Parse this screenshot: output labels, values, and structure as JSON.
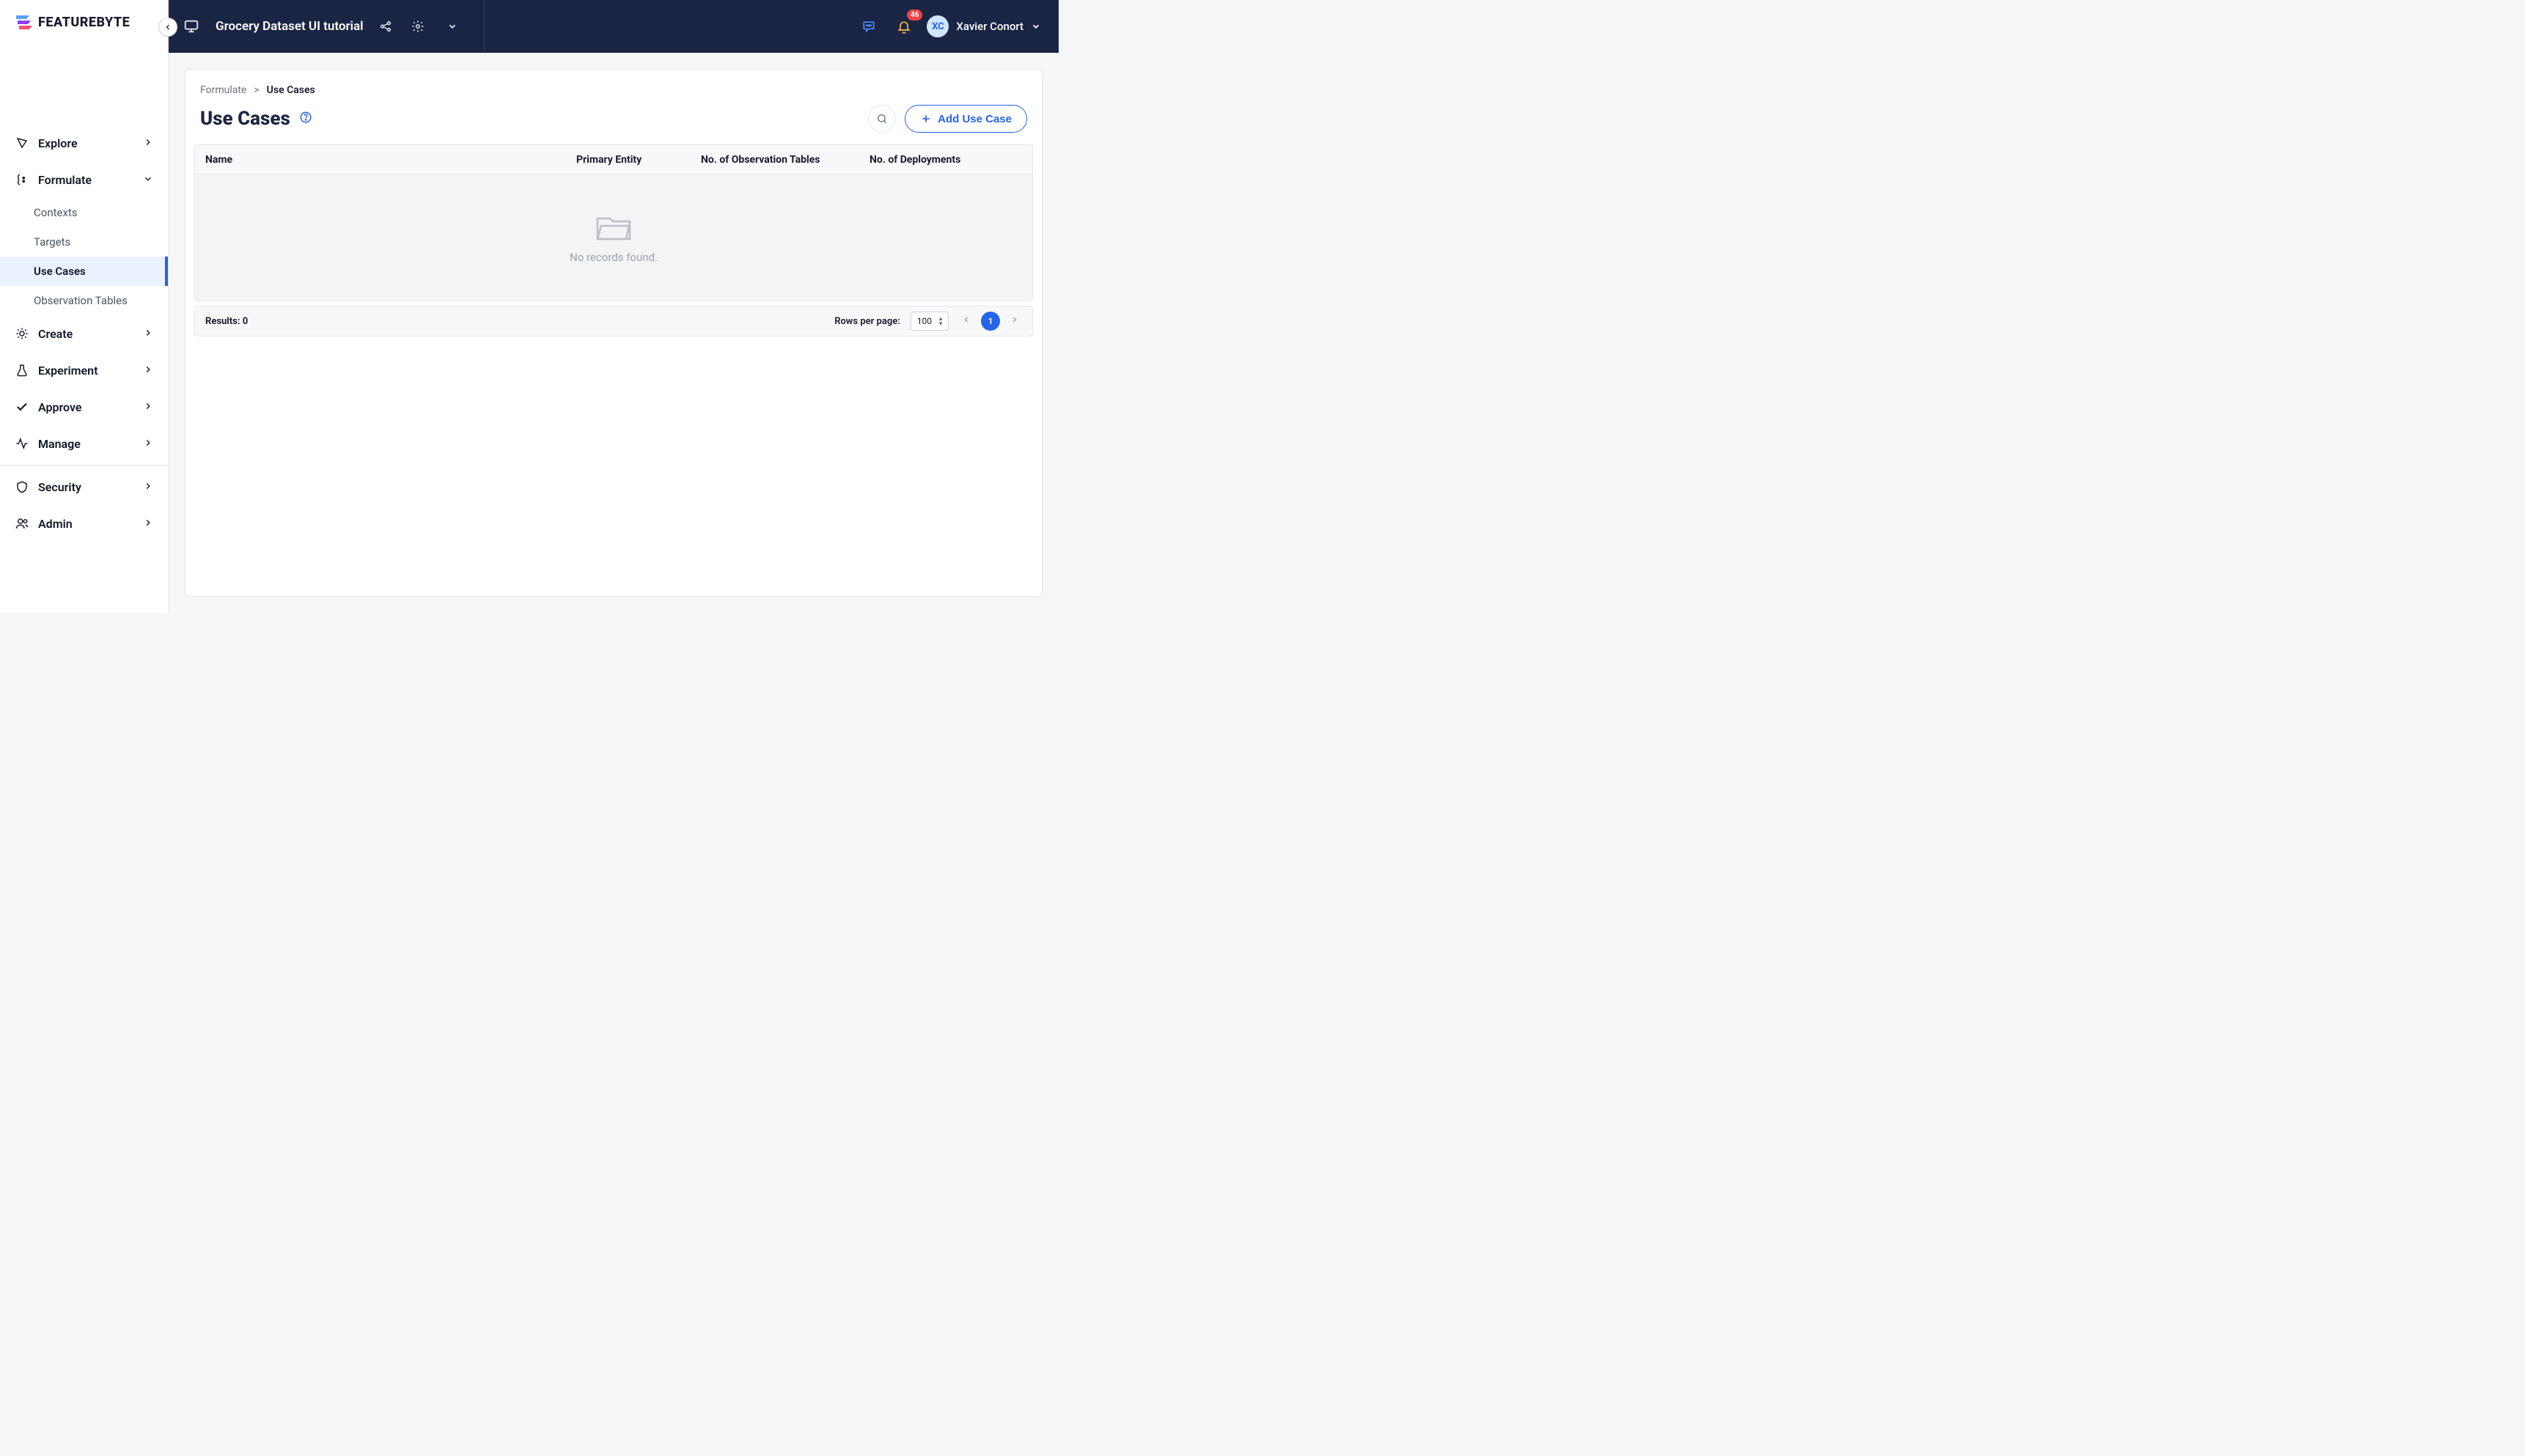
{
  "brand": "FEATUREBYTE",
  "header": {
    "project_title": "Grocery Dataset UI tutorial",
    "notification_count": "46",
    "user_initials": "XC",
    "user_name": "Xavier Conort"
  },
  "sidebar": {
    "items": [
      {
        "label": "Explore"
      },
      {
        "label": "Formulate"
      },
      {
        "label": "Create"
      },
      {
        "label": "Experiment"
      },
      {
        "label": "Approve"
      },
      {
        "label": "Manage"
      },
      {
        "label": "Security"
      },
      {
        "label": "Admin"
      }
    ],
    "formulate_sub": [
      {
        "label": "Contexts"
      },
      {
        "label": "Targets"
      },
      {
        "label": "Use Cases"
      },
      {
        "label": "Observation Tables"
      }
    ]
  },
  "breadcrumb": {
    "parent": "Formulate",
    "separator": ">",
    "current": "Use Cases"
  },
  "page": {
    "title": "Use Cases",
    "add_button": "Add Use Case"
  },
  "table": {
    "columns": {
      "name": "Name",
      "primary_entity": "Primary Entity",
      "obs_tables": "No. of Observation Tables",
      "deployments": "No. of Deployments"
    },
    "empty_message": "No records found."
  },
  "footer": {
    "results_label": "Results: 0",
    "rows_per_page_label": "Rows per page:",
    "rows_per_page_value": "100",
    "current_page": "1"
  }
}
